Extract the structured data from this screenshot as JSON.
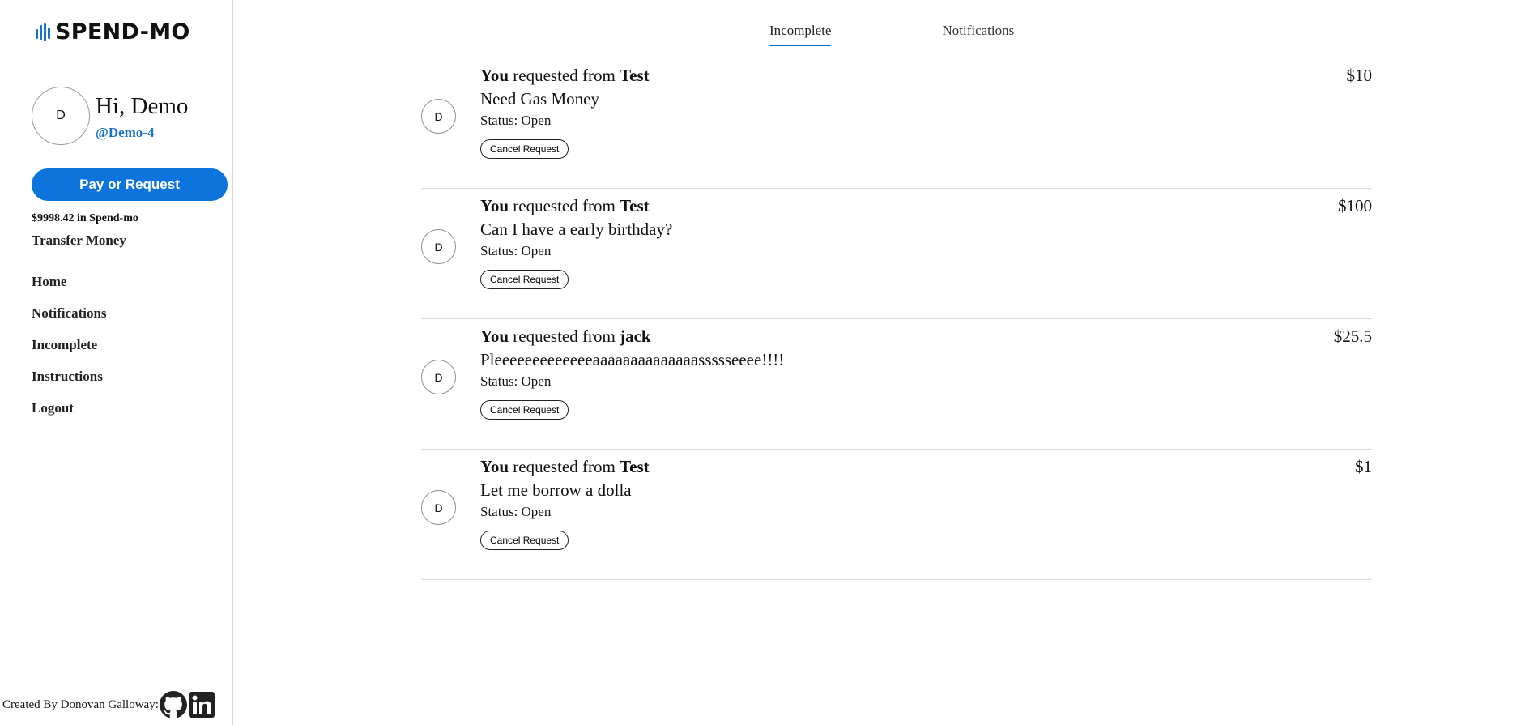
{
  "app": {
    "logo_text": "SPEND-MO",
    "brand_color": "#0c74dc"
  },
  "profile": {
    "avatar_initial": "D",
    "greeting": "Hi, Demo",
    "handle": "@Demo-4",
    "balance": "$9998.42 in Spend-mo"
  },
  "sidebar": {
    "pay_button": "Pay or Request",
    "transfer": "Transfer Money",
    "nav": [
      {
        "label": "Home"
      },
      {
        "label": "Notifications"
      },
      {
        "label": "Incomplete"
      },
      {
        "label": "Instructions"
      },
      {
        "label": "Logout"
      }
    ],
    "credit": "Created By Donovan Galloway:",
    "credit_icons": [
      "github-icon",
      "linkedin-icon"
    ]
  },
  "tabs": [
    {
      "label": "Incomplete",
      "active": true
    },
    {
      "label": "Notifications",
      "active": false
    }
  ],
  "requests": [
    {
      "avatar": "D",
      "actor": "You",
      "verb": "requested from",
      "target": "Test",
      "amount": "$10",
      "note": "Need Gas Money",
      "status": "Status: Open",
      "action": "Cancel Request"
    },
    {
      "avatar": "D",
      "actor": "You",
      "verb": "requested from",
      "target": "Test",
      "amount": "$100",
      "note": "Can I have a early birthday?",
      "status": "Status: Open",
      "action": "Cancel Request"
    },
    {
      "avatar": "D",
      "actor": "You",
      "verb": "requested from",
      "target": "jack",
      "amount": "$25.5",
      "note": "Pleeeeeeeeeeeeeaaaaaaaaaaaaaassssseeee!!!!",
      "status": "Status: Open",
      "action": "Cancel Request"
    },
    {
      "avatar": "D",
      "actor": "You",
      "verb": "requested from",
      "target": "Test",
      "amount": "$1",
      "note": "Let me borrow a dolla",
      "status": "Status: Open",
      "action": "Cancel Request"
    }
  ]
}
